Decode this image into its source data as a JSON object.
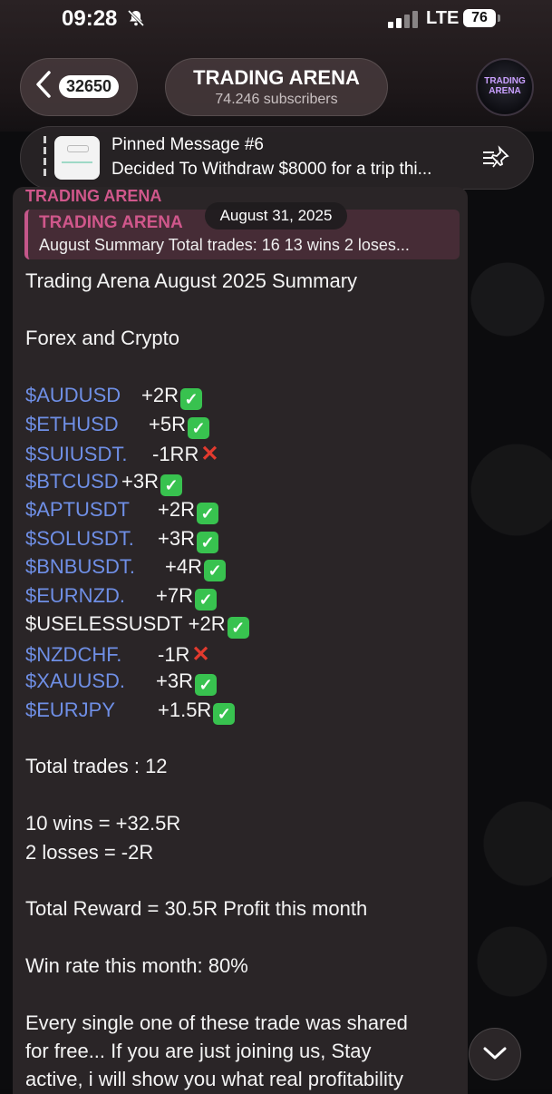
{
  "status_bar": {
    "time": "09:28",
    "network": "LTE",
    "battery": "76"
  },
  "header": {
    "back_count": "32650",
    "title": "TRADING ARENA",
    "subscribers": "74.246 subscribers",
    "avatar_text": "TRADING ARENA"
  },
  "pinned": {
    "title": "Pinned Message #6",
    "text": "Decided To Withdraw $8000 for a trip thi..."
  },
  "message": {
    "sender": "TRADING ARENA",
    "date_chip": "August 31, 2025",
    "reply": {
      "title": "TRADING ARENA",
      "text": "August Summary Total trades: 16 13 wins 2 loses..."
    },
    "lines": [
      "Trading Arena August 2025 Summary",
      "Forex and Crypto",
      "Total trades : 12",
      "10 wins =   +32.5R",
      "2 losses = -2R",
      "Total Reward = 30.5R Profit this month",
      "Win rate this month: 80%",
      "Every single one of these trade was shared",
      "for free... If you are just joining us, Stay",
      "active, i will show you what real profitability"
    ],
    "trades": [
      {
        "symbol": "$AUDUSD",
        "result": "+2R",
        "win": true
      },
      {
        "symbol": "$ETHUSD",
        "result": "+5R",
        "win": true
      },
      {
        "symbol": "$SUIUSDT.",
        "result": "-1RR",
        "win": false
      },
      {
        "symbol": "$BTCUSD",
        "result": "+3R",
        "win": true
      },
      {
        "symbol": "$APTUSDT",
        "result": "+2R",
        "win": true
      },
      {
        "symbol": "$SOLUSDT.",
        "result": "+3R",
        "win": true
      },
      {
        "symbol": "$BNBUSDT.",
        "result": "+4R",
        "win": true
      },
      {
        "symbol": "$EURNZD.",
        "result": "+7R",
        "win": true
      },
      {
        "symbol": "$USELESSUSDT",
        "result": "+2R",
        "win": true
      },
      {
        "symbol": "$NZDCHF.",
        "result": "-1R",
        "win": false
      },
      {
        "symbol": "$XAUUSD.",
        "result": "+3R",
        "win": true
      },
      {
        "symbol": "$EURJPY",
        "result": "+1.5R",
        "win": true
      }
    ]
  },
  "icons": {
    "check": "✓",
    "cross": "✕"
  },
  "colors": {
    "accent_pink": "#d0578b",
    "link_blue": "#6f8fe6",
    "win_green": "#38c24f",
    "loss_red": "#e23a2e"
  }
}
